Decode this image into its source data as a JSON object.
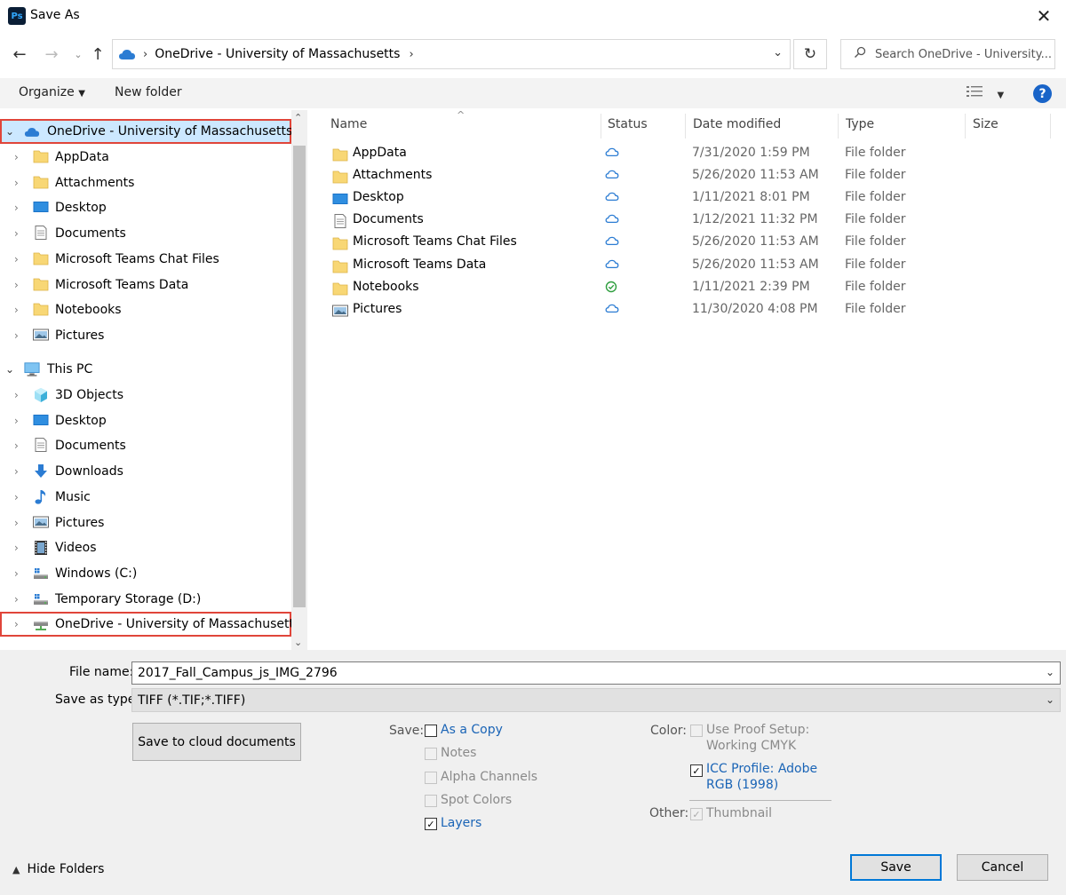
{
  "window": {
    "title": "Save As",
    "app_icon_text": "Ps"
  },
  "address": {
    "crumb": "OneDrive - University of Massachusetts"
  },
  "search": {
    "placeholder": "Search OneDrive - University..."
  },
  "toolbar": {
    "organize": "Organize",
    "new_folder": "New folder"
  },
  "nav": {
    "onedrive_root": "OneDrive - University of Massachusetts",
    "onedrive_items": [
      {
        "label": "AppData",
        "icon": "folder-icon"
      },
      {
        "label": "Attachments",
        "icon": "folder-icon"
      },
      {
        "label": "Desktop",
        "icon": "desktop-icon"
      },
      {
        "label": "Documents",
        "icon": "documents-icon"
      },
      {
        "label": "Microsoft Teams Chat Files",
        "icon": "folder-icon"
      },
      {
        "label": "Microsoft Teams Data",
        "icon": "folder-icon"
      },
      {
        "label": "Notebooks",
        "icon": "folder-icon"
      },
      {
        "label": "Pictures",
        "icon": "pictures-icon"
      }
    ],
    "this_pc": "This PC",
    "pc_items": [
      {
        "label": "3D Objects",
        "icon": "3d-objects-icon"
      },
      {
        "label": "Desktop",
        "icon": "desktop-icon"
      },
      {
        "label": "Documents",
        "icon": "documents-icon"
      },
      {
        "label": "Downloads",
        "icon": "downloads-icon"
      },
      {
        "label": "Music",
        "icon": "music-icon"
      },
      {
        "label": "Pictures",
        "icon": "pictures-icon"
      },
      {
        "label": "Videos",
        "icon": "videos-icon"
      },
      {
        "label": "Windows (C:)",
        "icon": "drive-icon"
      },
      {
        "label": "Temporary Storage (D:)",
        "icon": "drive-icon"
      },
      {
        "label": "OneDrive - University of Massachusetts (\\\\",
        "icon": "network-drive-icon"
      }
    ]
  },
  "columns": {
    "name": "Name",
    "status": "Status",
    "date": "Date modified",
    "type": "Type",
    "size": "Size"
  },
  "files": [
    {
      "name": "AppData",
      "status": "cloud",
      "date": "7/31/2020 1:59 PM",
      "type": "File folder",
      "icon": "folder-icon"
    },
    {
      "name": "Attachments",
      "status": "cloud",
      "date": "5/26/2020 11:53 AM",
      "type": "File folder",
      "icon": "folder-icon"
    },
    {
      "name": "Desktop",
      "status": "cloud",
      "date": "1/11/2021 8:01 PM",
      "type": "File folder",
      "icon": "desktop-icon"
    },
    {
      "name": "Documents",
      "status": "cloud",
      "date": "1/12/2021 11:32 PM",
      "type": "File folder",
      "icon": "documents-icon"
    },
    {
      "name": "Microsoft Teams Chat Files",
      "status": "cloud",
      "date": "5/26/2020 11:53 AM",
      "type": "File folder",
      "icon": "folder-icon"
    },
    {
      "name": "Microsoft Teams Data",
      "status": "cloud",
      "date": "5/26/2020 11:53 AM",
      "type": "File folder",
      "icon": "folder-icon"
    },
    {
      "name": "Notebooks",
      "status": "synced",
      "date": "1/11/2021 2:39 PM",
      "type": "File folder",
      "icon": "folder-icon"
    },
    {
      "name": "Pictures",
      "status": "cloud",
      "date": "11/30/2020 4:08 PM",
      "type": "File folder",
      "icon": "pictures-icon"
    }
  ],
  "form": {
    "file_name_label": "File name:",
    "file_name_value": "2017_Fall_Campus_js_IMG_2796",
    "save_type_label": "Save as type:",
    "save_type_value": "TIFF (*.TIF;*.TIFF)",
    "cloud_button": "Save to cloud documents",
    "save_label": "Save:",
    "save_options": [
      {
        "label": "As a Copy",
        "checked": false,
        "enabled": true
      },
      {
        "label": "Notes",
        "checked": false,
        "enabled": false
      },
      {
        "label": "Alpha Channels",
        "checked": false,
        "enabled": false
      },
      {
        "label": "Spot Colors",
        "checked": false,
        "enabled": false
      },
      {
        "label": "Layers",
        "checked": true,
        "enabled": true
      }
    ],
    "color_label": "Color:",
    "proof_setup_line1": "Use Proof Setup:",
    "proof_setup_line2": "Working CMYK",
    "icc_line1": "ICC Profile:  Adobe",
    "icc_line2": "RGB (1998)",
    "other_label": "Other:",
    "thumbnail": "Thumbnail"
  },
  "footer": {
    "hide_folders": "Hide Folders",
    "save": "Save",
    "cancel": "Cancel"
  },
  "colors": {
    "accent": "#0078d7",
    "highlight": "#e0453a",
    "cloud": "#2b7cd3",
    "synced": "#2e9e3e",
    "folder": "#f8d775"
  }
}
